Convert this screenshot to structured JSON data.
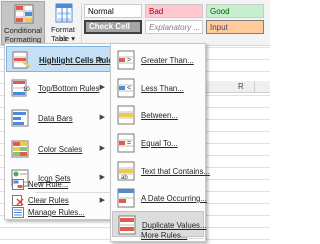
{
  "ribbon": {
    "conditional_formatting": {
      "line1": "Conditional",
      "line2": "Formatting ▾"
    },
    "format_as_table": {
      "line1": "Format as",
      "line2": "Table ▾"
    },
    "cell_styles": {
      "normal": "Normal",
      "bad": "Bad",
      "good": "Good",
      "check_cell": "Check Cell",
      "explanatory": "Explanatory ...",
      "input": "Input"
    }
  },
  "sheet": {
    "column_letter": "R"
  },
  "menu": {
    "items": [
      {
        "label": "Highlight Cells Rules",
        "icon": "highlight-cells-icon",
        "has_submenu": true,
        "selected": true
      },
      {
        "label": "Top/Bottom Rules",
        "icon": "top-bottom-icon",
        "has_submenu": true
      },
      {
        "label": "Data Bars",
        "icon": "data-bars-icon",
        "has_submenu": true
      },
      {
        "label": "Color Scales",
        "icon": "color-scales-icon",
        "has_submenu": true
      },
      {
        "label": "Icon Sets",
        "icon": "icon-sets-icon",
        "has_submenu": true
      }
    ],
    "small_items": [
      {
        "label": "New Rule...",
        "icon": "new-rule-icon"
      },
      {
        "label": "Clear Rules",
        "icon": "clear-rules-icon",
        "has_submenu": true
      },
      {
        "label": "Manage Rules...",
        "icon": "manage-rules-icon"
      }
    ]
  },
  "submenu": {
    "items": [
      {
        "label": "Greater Than...",
        "icon": "greater-than-icon"
      },
      {
        "label": "Less Than...",
        "icon": "less-than-icon"
      },
      {
        "label": "Between...",
        "icon": "between-icon"
      },
      {
        "label": "Equal To...",
        "icon": "equal-to-icon"
      },
      {
        "label": "Text that Contains...",
        "icon": "text-contains-icon"
      },
      {
        "label": "A Date Occurring...",
        "icon": "date-occurring-icon"
      },
      {
        "label": "Duplicate Values...",
        "icon": "duplicate-values-icon",
        "hovered": true
      }
    ],
    "more_rules": "More Rules..."
  },
  "colors": {
    "selected_bg": "#c4dff6",
    "hover_bg": "#dcdcdc",
    "bad_bg": "#ffc7ce",
    "good_bg": "#c6efce",
    "input_bg": "#ffcc99",
    "check_cell_bg": "#a5a5a5"
  }
}
